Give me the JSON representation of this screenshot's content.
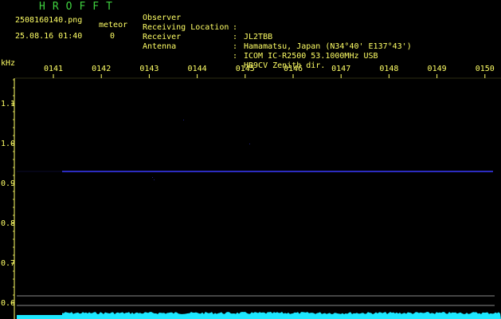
{
  "header": {
    "app_title": "HROFFT",
    "filename": "2508160140.png",
    "datetime": "25.08.16 01:40",
    "meteor_label": "meteor",
    "meteor_count": "0"
  },
  "station": [
    {
      "key": "Observer",
      "sep": ":",
      "value": "JL2TBB"
    },
    {
      "key": "Receiving Location",
      "sep": ":",
      "value": "Hamamatsu, Japan (N34°40' E137°43')"
    },
    {
      "key": "Receiver",
      "sep": ":",
      "value": "ICOM IC-R2500 53.1000MHz USB"
    },
    {
      "key": "Antenna",
      "sep": ":",
      "value": "HB9CV Zenith dir."
    }
  ],
  "chart_data": {
    "type": "heatmap",
    "title": "",
    "ylabel": "kHz",
    "xlabel": "",
    "x_ticks": [
      "0141",
      "0142",
      "0143",
      "0144",
      "0145",
      "0146",
      "0147",
      "0148",
      "0149",
      "0150"
    ],
    "y_ticks": [
      "1.1",
      "1.0",
      "0.9",
      "0.8",
      "0.7",
      "0.6"
    ],
    "y_tick_values": [
      1.1,
      1.0,
      0.9,
      0.8,
      0.7,
      0.6
    ],
    "ylim": [
      0.59,
      1.2
    ],
    "signal_line_khz": 0.93,
    "signal_start_label": "0141",
    "colors": {
      "background": "#000000",
      "signal": "#3a3aff",
      "noise_band": "#1ee8ff",
      "reference_line": "#8a8a8a",
      "text": "#ffff66",
      "title": "#3fd23f"
    }
  }
}
